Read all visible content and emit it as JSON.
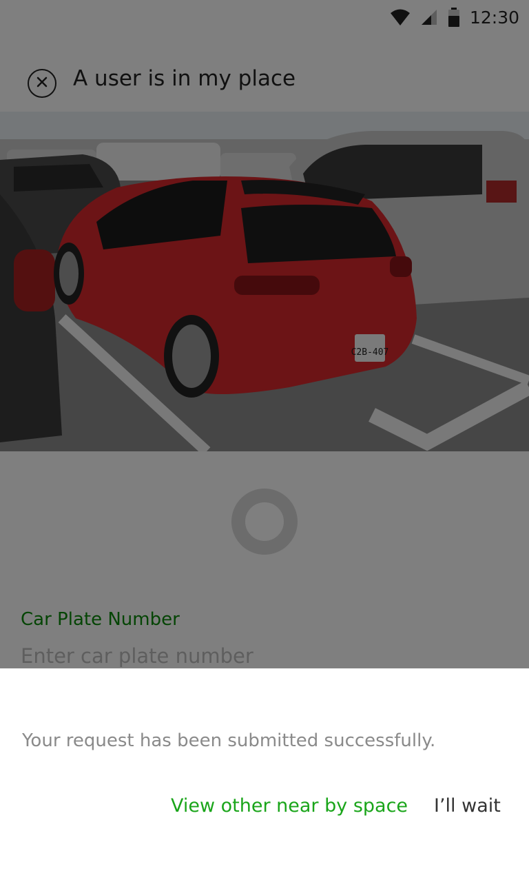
{
  "status_bar": {
    "time": "12:30",
    "icons": [
      "wifi-icon",
      "cell-signal-icon",
      "battery-icon"
    ]
  },
  "app_bar": {
    "close_icon": "close-circle-icon",
    "title": "A user is in my place"
  },
  "photo": {
    "description_icon": "parking-photo",
    "plate_text": "C2B-407"
  },
  "form": {
    "label": "Car Plate Number",
    "placeholder": "Enter car plate number",
    "value": ""
  },
  "dialog": {
    "message": "Your request has been submitted successfully.",
    "view_other_label": "View other near by space",
    "wait_label": "I’ll wait"
  },
  "colors": {
    "accent_green": "#1aa51a",
    "label_green": "#0a8a0a",
    "scrim": "rgba(0,0,0,0.5)"
  }
}
